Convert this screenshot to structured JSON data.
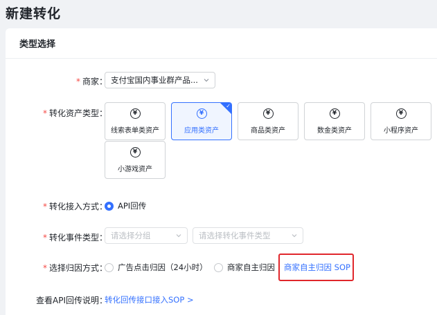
{
  "page": {
    "title": "新建转化"
  },
  "section": {
    "title": "类型选择"
  },
  "merchant": {
    "label": "商家：",
    "value": "支付宝国内事业群产品..."
  },
  "asset_type": {
    "label": "转化资产类型：",
    "options": [
      {
        "label": "线索表单类资产",
        "icon": "yen-coin-icon"
      },
      {
        "label": "应用类资产",
        "icon": "yen-coin-icon",
        "selected": true
      },
      {
        "label": "商品类资产",
        "icon": "yen-coin-icon"
      },
      {
        "label": "数金类资产",
        "icon": "yen-coin-icon"
      },
      {
        "label": "小程序资产",
        "icon": "yen-coin-icon"
      },
      {
        "label": "小游戏资产",
        "icon": "yen-coin-icon"
      }
    ],
    "coin_glyph": "¥"
  },
  "access_method": {
    "label": "转化接入方式：",
    "option": "API回传"
  },
  "event_type": {
    "label": "转化事件类型：",
    "group_placeholder": "请选择分组",
    "event_placeholder": "请选择转化事件类型"
  },
  "attribution": {
    "label": "选择归因方式：",
    "option_ad_click": "广告点击归因（24小时）",
    "option_merchant": "商家自主归因",
    "sop_link": "商家自主归因 SOP"
  },
  "api_doc": {
    "label": "查看API回传说明：",
    "link": "转化回传接口接入SOP >"
  },
  "colors": {
    "accent": "#3370ff",
    "required": "#f54a45",
    "highlight": "#e0262b"
  }
}
